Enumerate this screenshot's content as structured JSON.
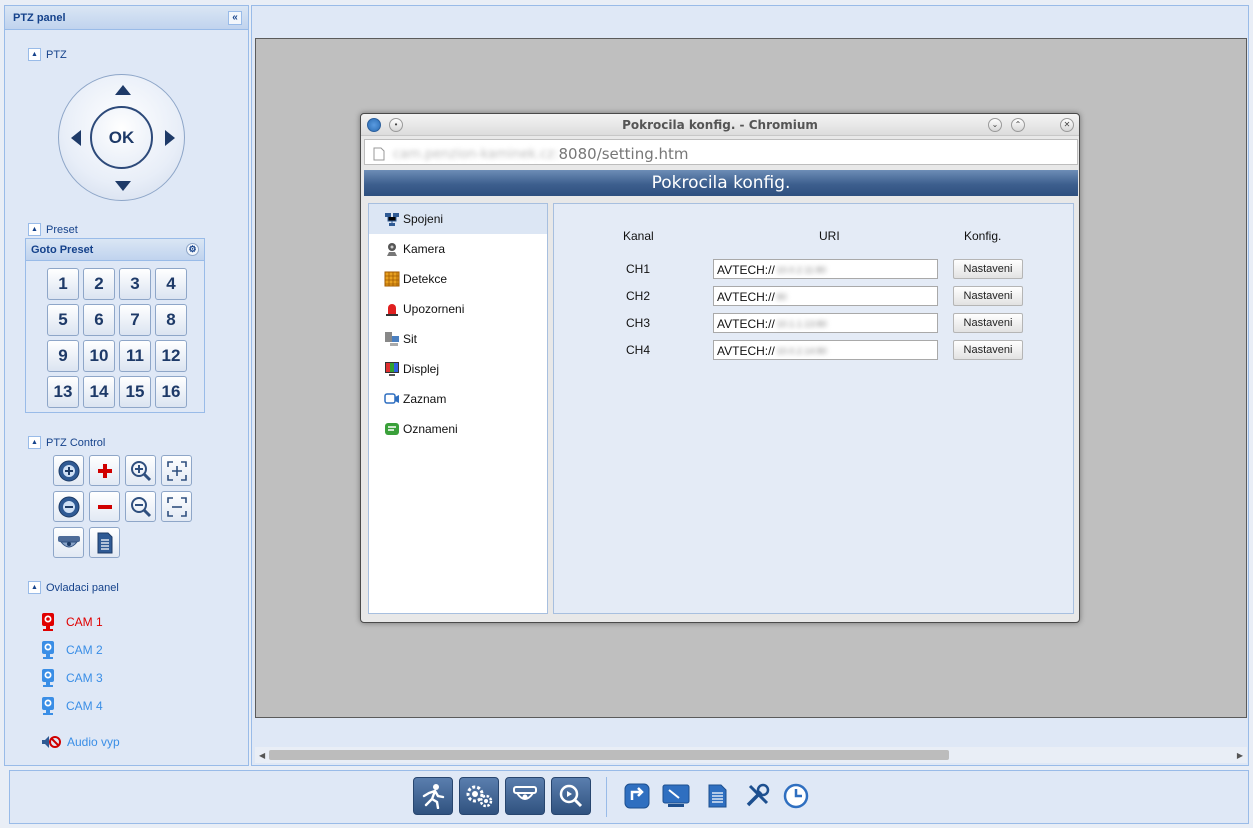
{
  "left_panel": {
    "title": "PTZ panel",
    "collapse_glyph": "«",
    "sections": {
      "ptz": "PTZ",
      "preset": "Preset",
      "ptz_control": "PTZ Control",
      "control_panel": "Ovladaci panel"
    },
    "ptz_ok_label": "OK",
    "preset_header": "Goto Preset",
    "presets": [
      "1",
      "2",
      "3",
      "4",
      "5",
      "6",
      "7",
      "8",
      "9",
      "10",
      "11",
      "12",
      "13",
      "14",
      "15",
      "16"
    ],
    "cameras": [
      {
        "label": "CAM 1",
        "color": "#e00000"
      },
      {
        "label": "CAM 2",
        "color": "#3a8ee6"
      },
      {
        "label": "CAM 3",
        "color": "#3a8ee6"
      },
      {
        "label": "CAM 4",
        "color": "#3a8ee6"
      }
    ],
    "audio_label": "Audio vyp"
  },
  "browser_window": {
    "title": "Pokrocila konfig. - Chromium",
    "url_host": "cam.penzion-kaminek.cz:",
    "url_path": "8080/setting.htm",
    "page_title": "Pokrocila konfig.",
    "nav": [
      {
        "label": "Spojeni",
        "icon": "network-icon"
      },
      {
        "label": "Kamera",
        "icon": "camera-icon"
      },
      {
        "label": "Detekce",
        "icon": "detection-grid-icon"
      },
      {
        "label": "Upozorneni",
        "icon": "alarm-icon"
      },
      {
        "label": "Sit",
        "icon": "network-computers-icon"
      },
      {
        "label": "Displej",
        "icon": "display-icon"
      },
      {
        "label": "Zaznam",
        "icon": "record-icon"
      },
      {
        "label": "Oznameni",
        "icon": "notification-icon"
      }
    ],
    "table": {
      "headers": {
        "kanal": "Kanal",
        "uri": "URI",
        "config": "Konfig."
      },
      "rows": [
        {
          "channel": "CH1",
          "uri_prefix": "AVTECH://",
          "uri_masked": "10.0.2.11:80",
          "button": "Nastaveni"
        },
        {
          "channel": "CH2",
          "uri_prefix": "AVTECH://",
          "uri_masked": "80",
          "button": "Nastaveni"
        },
        {
          "channel": "CH3",
          "uri_prefix": "AVTECH://",
          "uri_masked": "10.1.1.13:80",
          "button": "Nastaveni"
        },
        {
          "channel": "CH4",
          "uri_prefix": "AVTECH://",
          "uri_masked": "10.0.2.14:80",
          "button": "Nastaveni"
        }
      ]
    }
  },
  "bottom_toolbar": {
    "dark_buttons": [
      "motion-run-icon",
      "settings-gears-icon",
      "dome-camera-icon",
      "search-playback-icon"
    ],
    "light_buttons": [
      "refresh-icon",
      "monitor-icon",
      "document-icon",
      "tools-icon",
      "clock-icon"
    ]
  }
}
